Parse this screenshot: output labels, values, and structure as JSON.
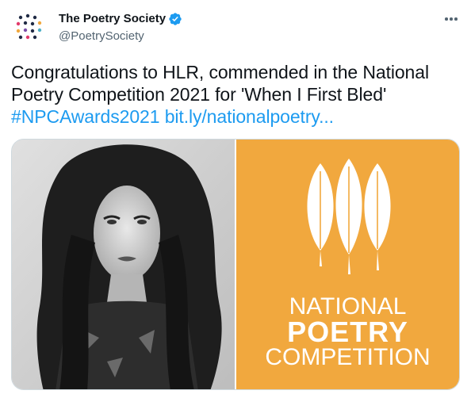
{
  "author": {
    "display_name": "The Poetry Society",
    "handle": "@PoetrySociety",
    "verified": true
  },
  "icons": {
    "avatar": "poetry-society-dots-logo",
    "verified": "verified-badge-icon",
    "more": "more-options-icon"
  },
  "tweet": {
    "text_before": "Congratulations to HLR, commended in the National Poetry Competition 2021 for 'When I First Bled'",
    "hashtag": "#NPCAwards2021",
    "link": "bit.ly/nationalpoetry..."
  },
  "media": {
    "right_image": {
      "line1": "NATIONAL",
      "line2": "POETRY",
      "line3": "COMPETITION"
    }
  },
  "colors": {
    "accent": "#1d9bf0",
    "orange": "#f1a83e",
    "text": "#0f1419",
    "secondary": "#536471"
  }
}
